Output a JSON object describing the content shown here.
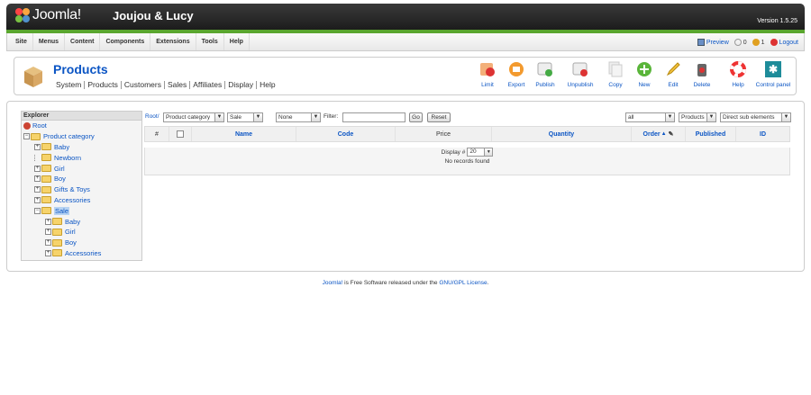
{
  "header": {
    "logo_text": "Joomla!",
    "site_name": "Joujou & Lucy",
    "version": "Version 1.5.25"
  },
  "menu": {
    "items": [
      "Site",
      "Menus",
      "Content",
      "Components",
      "Extensions",
      "Tools",
      "Help"
    ]
  },
  "status": {
    "preview": "Preview",
    "messages": "0",
    "users": "1",
    "logout": "Logout"
  },
  "page": {
    "title": "Products",
    "subnav": [
      "System",
      "Products",
      "Customers",
      "Sales",
      "Affiliates",
      "Display",
      "Help"
    ]
  },
  "toolbar": {
    "limit": "Limit",
    "export": "Export",
    "publish": "Publish",
    "unpublish": "Unpublish",
    "copy": "Copy",
    "new": "New",
    "edit": "Edit",
    "delete": "Delete",
    "help": "Help",
    "control_panel": "Control panel"
  },
  "explorer": {
    "title": "Explorer",
    "root": "Root",
    "product_category": "Product category",
    "items": [
      "Baby",
      "Newborn",
      "Girl",
      "Boy",
      "Gifts & Toys",
      "Accessories"
    ],
    "sale": "Sale",
    "sale_items": [
      "Baby",
      "Girl",
      "Boy",
      "Accessories"
    ]
  },
  "filters": {
    "root_link": "Root/",
    "category_select": "Product category",
    "sale_select": "Sale",
    "none_select": "None",
    "filter_label": "Filter:",
    "filter_value": "",
    "go": "Go",
    "reset": "Reset",
    "all_select": "all",
    "products_select": "Products",
    "sub_select": "Direct sub elements"
  },
  "grid": {
    "columns": {
      "num": "#",
      "name": "Name",
      "code": "Code",
      "price": "Price",
      "quantity": "Quantity",
      "order": "Order",
      "published": "Published",
      "id": "ID"
    },
    "display_label": "Display #",
    "display_value": "20",
    "no_records": "No records found"
  },
  "footer": {
    "joomla_link": "Joomla!",
    "middle_text": " is Free Software released under the ",
    "license_link": "GNU/GPL License",
    "end": "."
  }
}
